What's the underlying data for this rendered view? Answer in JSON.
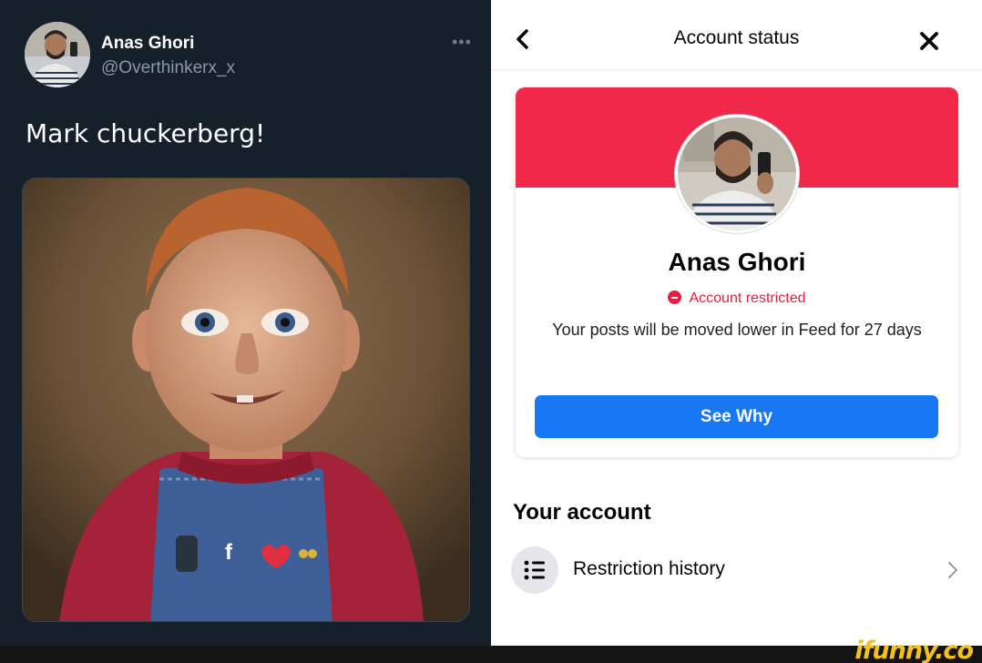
{
  "tweet": {
    "display_name": "Anas Ghori",
    "handle": "@Overthinkerx_x",
    "more_icon": "more-dots-icon",
    "text": "Mark chuckerberg!",
    "avatar_icon": "user-avatar"
  },
  "account_status": {
    "title": "Account status",
    "back_icon": "chevron-left-icon",
    "close_icon": "close-icon",
    "banner_color": "#f02849",
    "name": "Anas Ghori",
    "restriction_label": "Account restricted",
    "restriction_color": "#e41e3f",
    "restriction_description": "Your posts will be moved lower in Feed for 27 days",
    "see_why_label": "See Why",
    "button_color": "#1877f2"
  },
  "your_account": {
    "heading": "Your account",
    "items": [
      {
        "label": "Restriction history",
        "icon": "list-icon"
      }
    ]
  },
  "watermark": "ifunny.co"
}
